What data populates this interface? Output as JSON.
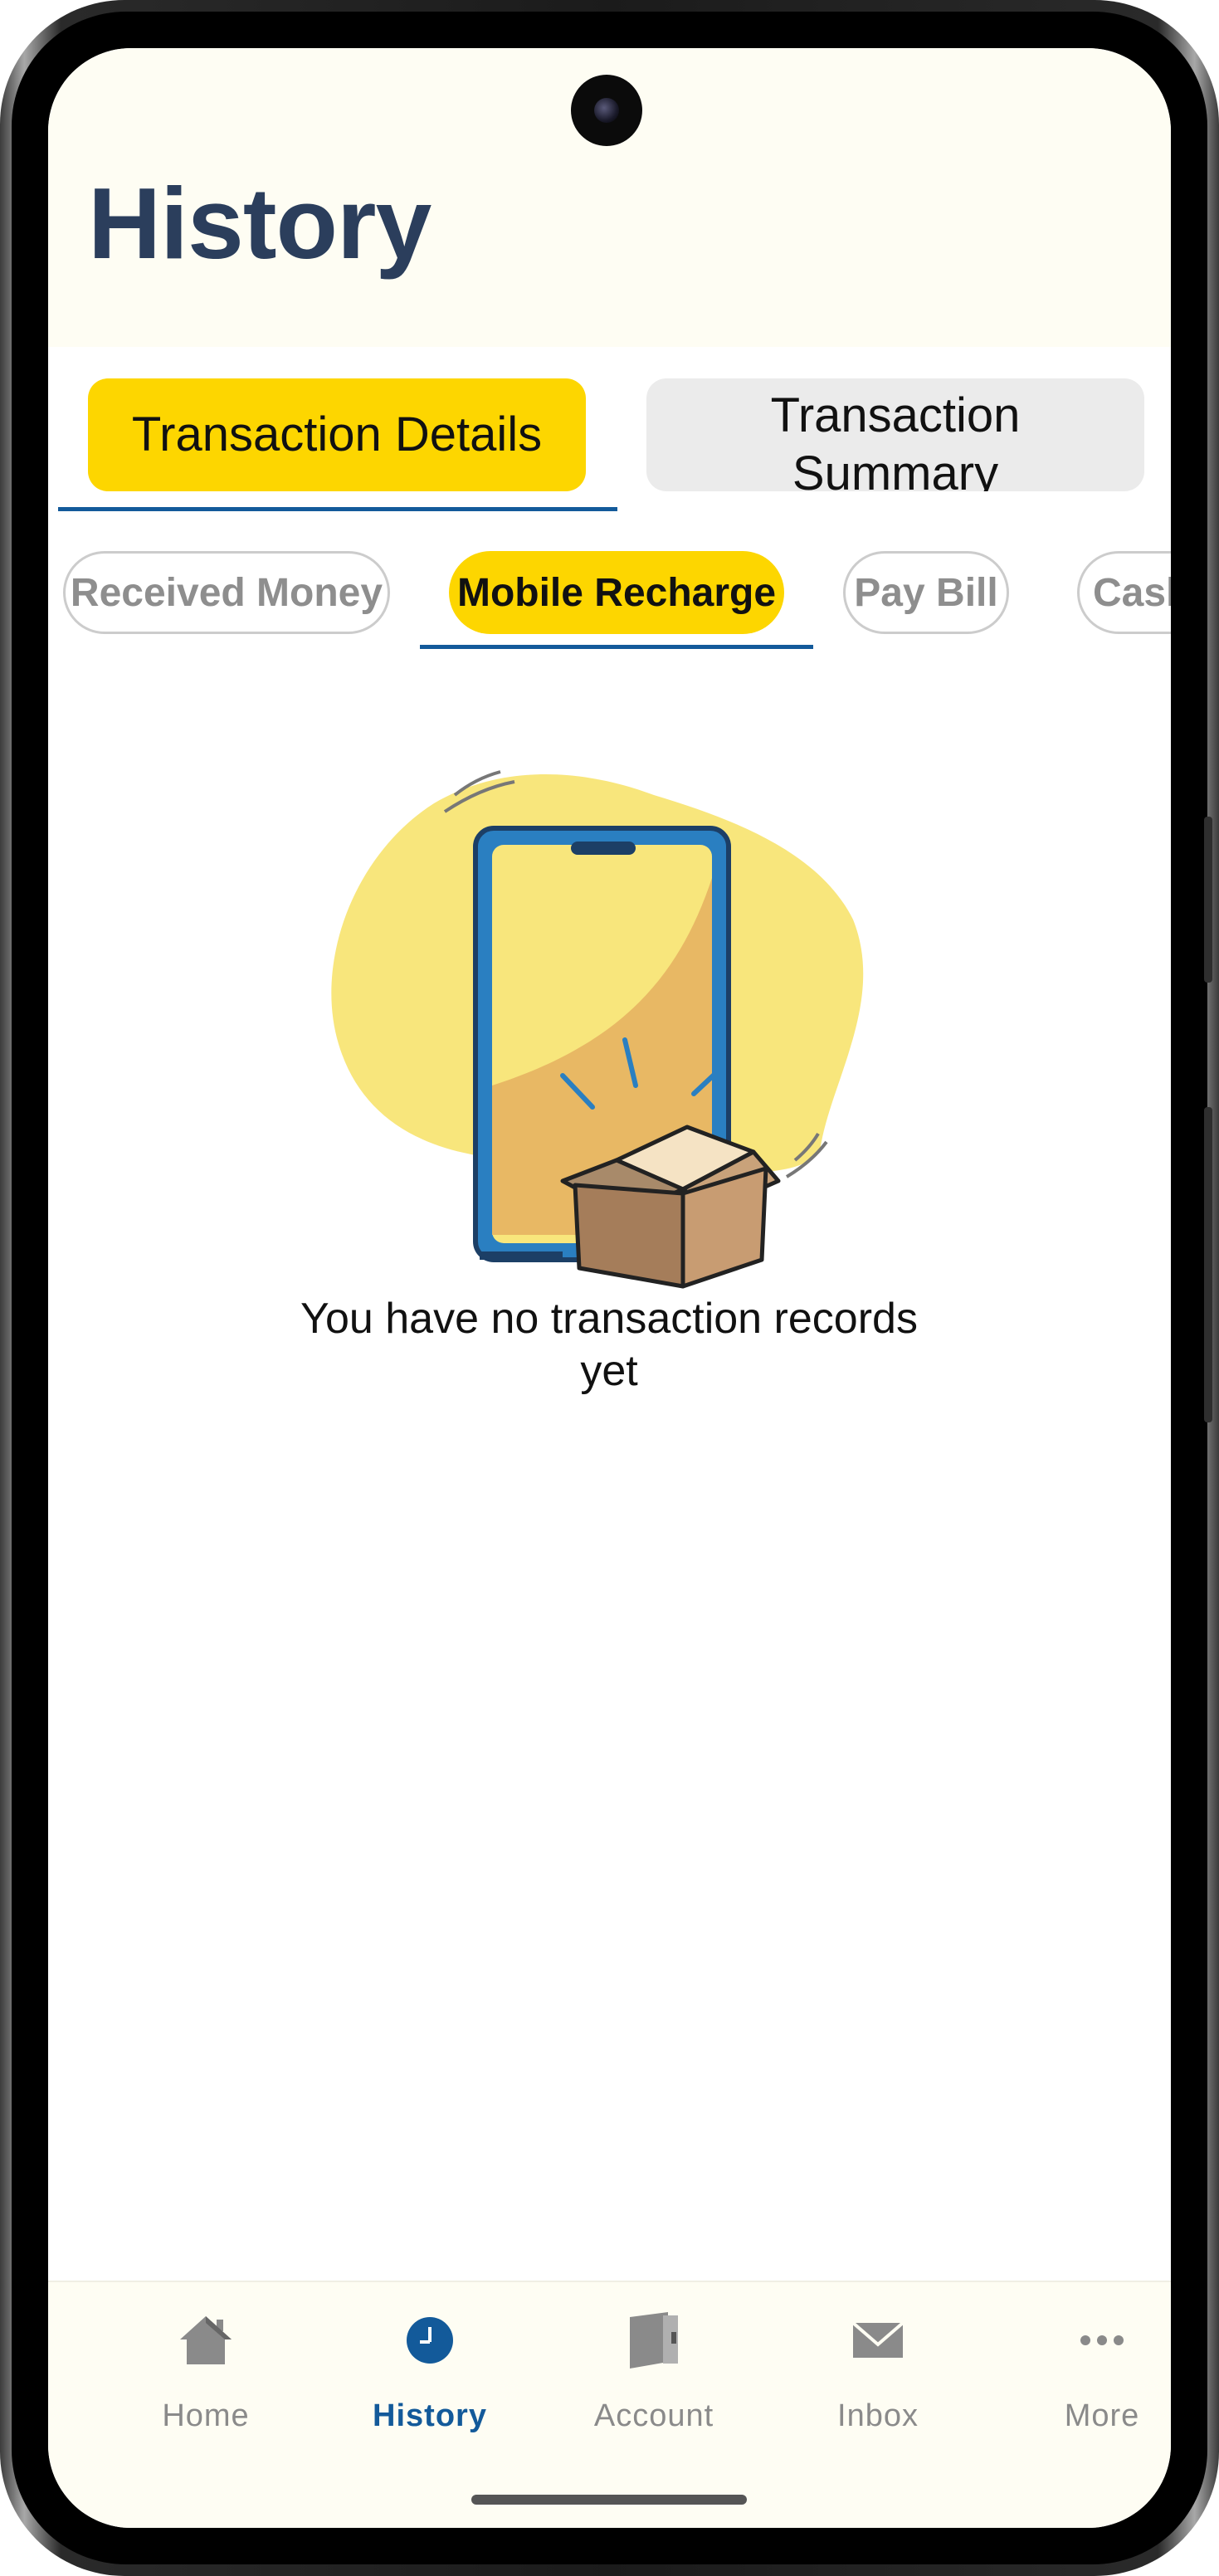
{
  "header": {
    "title": "History"
  },
  "main_tabs": [
    {
      "label": "Transaction Details",
      "active": true
    },
    {
      "label": "Transaction Summary",
      "active": false
    }
  ],
  "filter_chips": [
    {
      "label": "Received Money",
      "selected": false
    },
    {
      "label": "Mobile Recharge",
      "selected": true
    },
    {
      "label": "Pay Bill",
      "selected": false
    },
    {
      "label": "Cash",
      "selected": false
    }
  ],
  "empty_state": {
    "message": "You have no transaction records yet",
    "illustration": "phone-with-open-box"
  },
  "bottom_nav": [
    {
      "label": "Home",
      "icon": "home-icon",
      "active": false
    },
    {
      "label": "History",
      "icon": "clock-icon",
      "active": true
    },
    {
      "label": "Account",
      "icon": "book-icon",
      "active": false
    },
    {
      "label": "Inbox",
      "icon": "mail-icon",
      "active": false
    },
    {
      "label": "More",
      "icon": "more-icon",
      "active": false
    }
  ],
  "colors": {
    "accent_yellow": "#fdd600",
    "accent_blue": "#135a9a",
    "title_navy": "#2b3e5c",
    "header_bg": "#fefdf3"
  }
}
